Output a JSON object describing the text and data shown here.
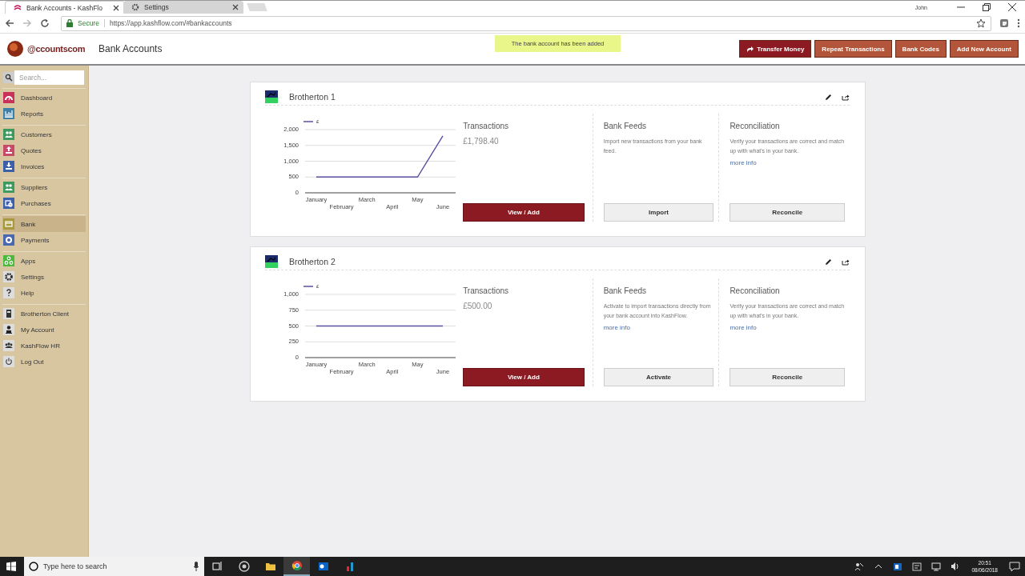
{
  "browser": {
    "tabs": [
      {
        "label": "Bank Accounts - KashFlo",
        "selected": true
      },
      {
        "label": "Settings",
        "selected": false
      }
    ],
    "user": "John",
    "secure_label": "Secure",
    "url": "https://app.kashflow.com/#bankaccounts"
  },
  "header": {
    "logo": "@ccountscom",
    "title": "Bank Accounts",
    "notice": "The bank account has been added",
    "buttons": [
      {
        "label": "Transfer Money",
        "kind": "primary"
      },
      {
        "label": "Repeat Transactions",
        "kind": "secondary"
      },
      {
        "label": "Bank Codes",
        "kind": "secondary"
      },
      {
        "label": "Add New Account",
        "kind": "secondary"
      }
    ]
  },
  "sidebar": {
    "search": {
      "placeholder": "Search..."
    },
    "groups": [
      [
        {
          "label": "Dashboard",
          "kind": "gauge",
          "color": "#c8315a",
          "selected": false
        },
        {
          "label": "Reports",
          "kind": "chart",
          "color": "#3d7fa6",
          "selected": false
        }
      ],
      [
        {
          "label": "Customers",
          "kind": "people",
          "color": "#3c9a5f",
          "selected": false
        },
        {
          "label": "Quotes",
          "kind": "upload",
          "color": "#c84a6a",
          "selected": false
        },
        {
          "label": "Invoices",
          "kind": "download",
          "color": "#3b5fa8",
          "selected": false
        }
      ],
      [
        {
          "label": "Suppliers",
          "kind": "people",
          "color": "#3c9a5f",
          "selected": false
        },
        {
          "label": "Purchases",
          "kind": "bag",
          "color": "#3b5fa8",
          "selected": false
        }
      ],
      [
        {
          "label": "Bank",
          "kind": "card",
          "color": "#a89a3c",
          "selected": true
        },
        {
          "label": "Payments",
          "kind": "coin",
          "color": "#4a68b0",
          "selected": false
        }
      ],
      [
        {
          "label": "Apps",
          "kind": "apps",
          "color": "#4cb83c",
          "selected": false
        },
        {
          "label": "Settings",
          "kind": "gear",
          "selected": false
        },
        {
          "label": "Help",
          "kind": "question",
          "selected": false
        }
      ],
      [
        {
          "label": "Brotherton Client",
          "kind": "building",
          "selected": false
        },
        {
          "label": "My Account",
          "kind": "person",
          "selected": false
        },
        {
          "label": "KashFlow HR",
          "kind": "group",
          "selected": false
        },
        {
          "label": "Log Out",
          "kind": "power",
          "selected": false
        }
      ]
    ]
  },
  "accounts": [
    {
      "name": "Brotherton 1",
      "chart_data": {
        "type": "line",
        "categories": [
          "January",
          "February",
          "March",
          "April",
          "May",
          "June"
        ],
        "series": [
          {
            "name": "£",
            "color": "#5a50a0",
            "values": [
              500,
              500,
              500,
              500,
              500,
              1800
            ]
          }
        ],
        "grid": true,
        "ylim": [
          0,
          2000
        ],
        "yticks": [
          {
            "value": 0,
            "label": "0"
          },
          {
            "value": 500,
            "label": "500"
          },
          {
            "value": 1000,
            "label": "1,000"
          },
          {
            "value": 1500,
            "label": "1,500"
          },
          {
            "value": 2000,
            "label": "2,000"
          }
        ]
      },
      "transactions": {
        "title": "Transactions",
        "amount": "£1,798.40",
        "button": "View / Add"
      },
      "bank_feeds": {
        "title": "Bank Feeds",
        "text": "Import new transactions from your bank feed.",
        "button": "Import"
      },
      "reconciliation": {
        "title": "Reconciliation",
        "text": "Verify your transactions are correct and match up with what's in your bank.",
        "link": "more info",
        "button": "Reconcile"
      }
    },
    {
      "name": "Brotherton 2",
      "chart_data": {
        "type": "line",
        "categories": [
          "January",
          "February",
          "March",
          "April",
          "May",
          "June"
        ],
        "series": [
          {
            "name": "£",
            "color": "#5a50a0",
            "values": [
              500,
              500,
              500,
              500,
              500,
              500
            ]
          }
        ],
        "grid": true,
        "ylim": [
          0,
          1000
        ],
        "yticks": [
          {
            "value": 0,
            "label": "0"
          },
          {
            "value": 250,
            "label": "250"
          },
          {
            "value": 500,
            "label": "500"
          },
          {
            "value": 750,
            "label": "750"
          },
          {
            "value": 1000,
            "label": "1,000"
          }
        ]
      },
      "transactions": {
        "title": "Transactions",
        "amount": "£500.00",
        "button": "View / Add"
      },
      "bank_feeds": {
        "title": "Bank Feeds",
        "text": "Activate to import transactions directly from your bank account into KashFlow.",
        "link": "more info",
        "button": "Activate"
      },
      "reconciliation": {
        "title": "Reconciliation",
        "text": "Verify your transactions are correct and match up with what's in your bank.",
        "link": "more info",
        "button": "Reconcile"
      }
    }
  ],
  "taskbar": {
    "search_placeholder": "Type here to search",
    "time": "20:51",
    "date": "08/06/2018"
  }
}
